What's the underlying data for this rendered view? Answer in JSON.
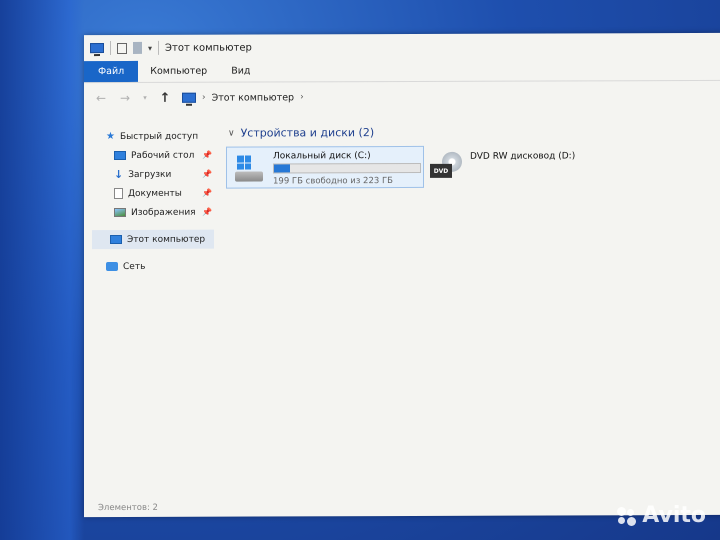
{
  "window": {
    "title": "Этот компьютер",
    "quick_access_icons": [
      "computer-icon",
      "properties-icon",
      "new-folder-icon",
      "customize-icon"
    ]
  },
  "ribbon": {
    "tabs": [
      "Файл",
      "Компьютер",
      "Вид"
    ],
    "active_tab": "Файл"
  },
  "address_bar": {
    "back_icon": "arrow-left-icon",
    "forward_icon": "arrow-right-icon",
    "recent_icon": "chevron-down-icon",
    "up_icon": "arrow-up-icon",
    "path": [
      "Этот компьютер"
    ]
  },
  "nav_pane": {
    "quick_access": "Быстрый доступ",
    "pinned": [
      {
        "label": "Рабочий стол",
        "icon": "desktop-icon"
      },
      {
        "label": "Загрузки",
        "icon": "downloads-icon"
      },
      {
        "label": "Документы",
        "icon": "documents-icon"
      },
      {
        "label": "Изображения",
        "icon": "pictures-icon"
      }
    ],
    "this_pc": "Этот компьютер",
    "network": "Сеть"
  },
  "content": {
    "group_title": "Устройства и диски (2)",
    "drives": [
      {
        "name": "Локальный диск (C:)",
        "free_text": "199 ГБ свободно из 223 ГБ",
        "used_fraction": 0.11,
        "icon": "windows-drive-icon"
      },
      {
        "name": "DVD RW дисковод (D:)",
        "icon": "dvd-drive-icon",
        "badge": "DVD"
      }
    ]
  },
  "status_bar": {
    "items_text": "Элементов: 2"
  },
  "watermark": {
    "text": "Avito"
  },
  "colors": {
    "accent": "#1966c8",
    "drive_bar": "#2678d6",
    "selection": "#dfe7f1",
    "group_title": "#1e3f8e"
  }
}
